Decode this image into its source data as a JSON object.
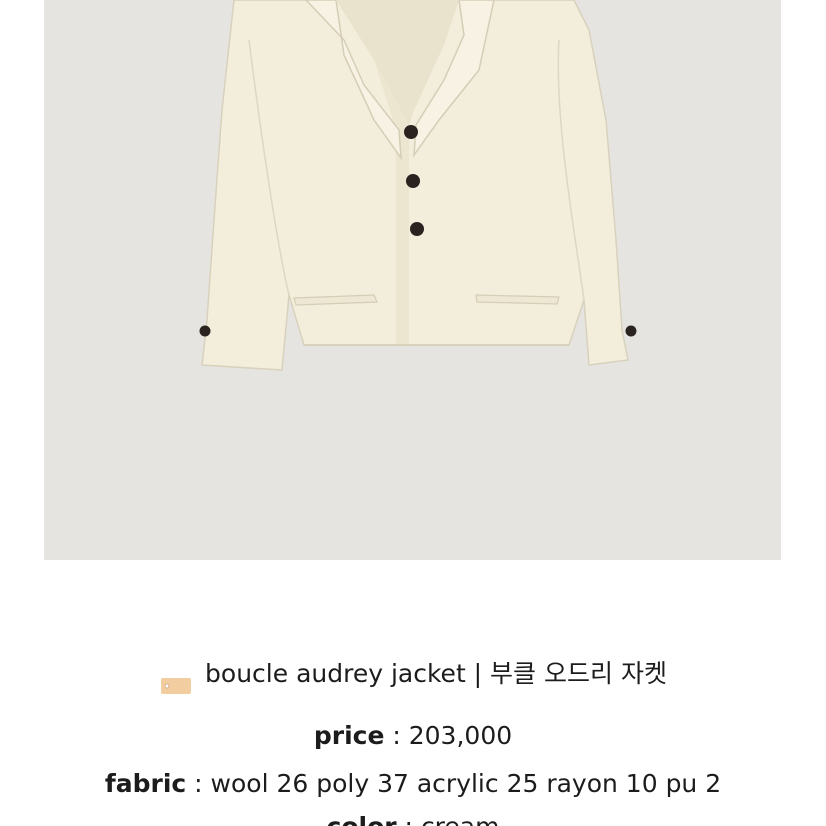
{
  "product": {
    "image_alt": "boucle audrey jacket",
    "name_icon": "tag-icon",
    "name": "boucle audrey jacket | 부클 오드리 자켓",
    "price_label": "price",
    "price_sep": " : ",
    "price_value": "203,000",
    "fabric_label": "fabric",
    "fabric_sep": " : ",
    "fabric_value": "wool 26 poly 37 acrylic 25 rayon 10 pu 2",
    "color_label": "color",
    "color_sep": " : ",
    "color_value": "cream"
  },
  "colors": {
    "photo_bg": "#e5e4e1",
    "jacket": "#f3eedc",
    "buttons": "#2a2320",
    "text": "#1c1c1c",
    "tag": "#f2cda0"
  }
}
